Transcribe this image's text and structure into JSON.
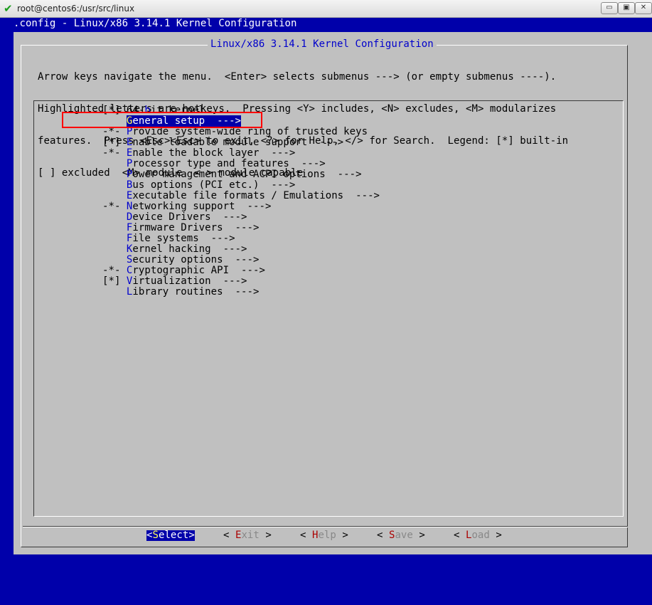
{
  "window": {
    "title": "root@centos6:/usr/src/linux",
    "minimize_glyph": "▭",
    "maximize_glyph": "▣",
    "close_glyph": "✕"
  },
  "terminal": {
    "caption": ".config - Linux/x86 3.14.1 Kernel Configuration"
  },
  "dialog": {
    "title": "Linux/x86 3.14.1 Kernel Configuration",
    "help_lines": [
      "Arrow keys navigate the menu.  <Enter> selects submenus ---> (or empty submenus ----).",
      "Highlighted letters are hotkeys.  Pressing <Y> includes, <N> excludes, <M> modularizes",
      "features.  Press <Esc><Esc> to exit, <?> for Help, </> for Search.  Legend: [*] built-in",
      "[ ] excluded  <M> module  < > module capable"
    ],
    "menu_items": [
      {
        "prefix": "[*] ",
        "pre": "64-",
        "hot": "b",
        "post": "it kernel",
        "selected": false
      },
      {
        "prefix": "    ",
        "pre": "",
        "hot": "G",
        "post": "eneral setup  --->",
        "selected": true
      },
      {
        "prefix": "-*- ",
        "pre": "",
        "hot": "P",
        "post": "rovide system-wide ring of trusted keys",
        "selected": false
      },
      {
        "prefix": "[*] ",
        "pre": "",
        "hot": "E",
        "post": "nable loadable module support  --->",
        "selected": false
      },
      {
        "prefix": "-*- ",
        "pre": "",
        "hot": "E",
        "post": "nable the block layer  --->",
        "selected": false
      },
      {
        "prefix": "    ",
        "pre": "",
        "hot": "P",
        "post": "rocessor type and features  --->",
        "selected": false
      },
      {
        "prefix": "    ",
        "pre": "",
        "hot": "P",
        "post": "ower management and ACPI options  --->",
        "selected": false
      },
      {
        "prefix": "    ",
        "pre": "",
        "hot": "B",
        "post": "us options (PCI etc.)  --->",
        "selected": false
      },
      {
        "prefix": "    ",
        "pre": "",
        "hot": "E",
        "post": "xecutable file formats / Emulations  --->",
        "selected": false
      },
      {
        "prefix": "-*- ",
        "pre": "",
        "hot": "N",
        "post": "etworking support  --->",
        "selected": false
      },
      {
        "prefix": "    ",
        "pre": "",
        "hot": "D",
        "post": "evice Drivers  --->",
        "selected": false
      },
      {
        "prefix": "    ",
        "pre": "",
        "hot": "F",
        "post": "irmware Drivers  --->",
        "selected": false
      },
      {
        "prefix": "    ",
        "pre": "",
        "hot": "F",
        "post": "ile systems  --->",
        "selected": false
      },
      {
        "prefix": "    ",
        "pre": "",
        "hot": "K",
        "post": "ernel hacking  --->",
        "selected": false
      },
      {
        "prefix": "    ",
        "pre": "",
        "hot": "S",
        "post": "ecurity options  --->",
        "selected": false
      },
      {
        "prefix": "-*- ",
        "pre": "",
        "hot": "C",
        "post": "ryptographic API  --->",
        "selected": false
      },
      {
        "prefix": "[*] ",
        "pre": "",
        "hot": "V",
        "post": "irtualization  --->",
        "selected": false
      },
      {
        "prefix": "    ",
        "pre": "",
        "hot": "L",
        "post": "ibrary routines  --->",
        "selected": false
      }
    ],
    "buttons": [
      {
        "open": "<",
        "hot": "S",
        "rest": "elect",
        "close": ">",
        "active": true
      },
      {
        "open": "< ",
        "hot": "E",
        "rest": "xit",
        "close": " >",
        "active": false
      },
      {
        "open": "< ",
        "hot": "H",
        "rest": "elp",
        "close": " >",
        "active": false
      },
      {
        "open": "< ",
        "hot": "S",
        "rest": "ave",
        "close": " >",
        "active": false
      },
      {
        "open": "< ",
        "hot": "L",
        "rest": "oad",
        "close": " >",
        "active": false
      }
    ]
  },
  "colors": {
    "terminal_bg": "#0000aa",
    "dialog_bg": "#c0c0c0",
    "title_fg": "#0000cc",
    "hotkey_fg": "#0000cc",
    "selected_bg": "#0000aa",
    "selected_hotkey_fg": "#ffff55",
    "button_hotkey_fg": "#aa0000",
    "annotation_box": "#ff0000"
  }
}
